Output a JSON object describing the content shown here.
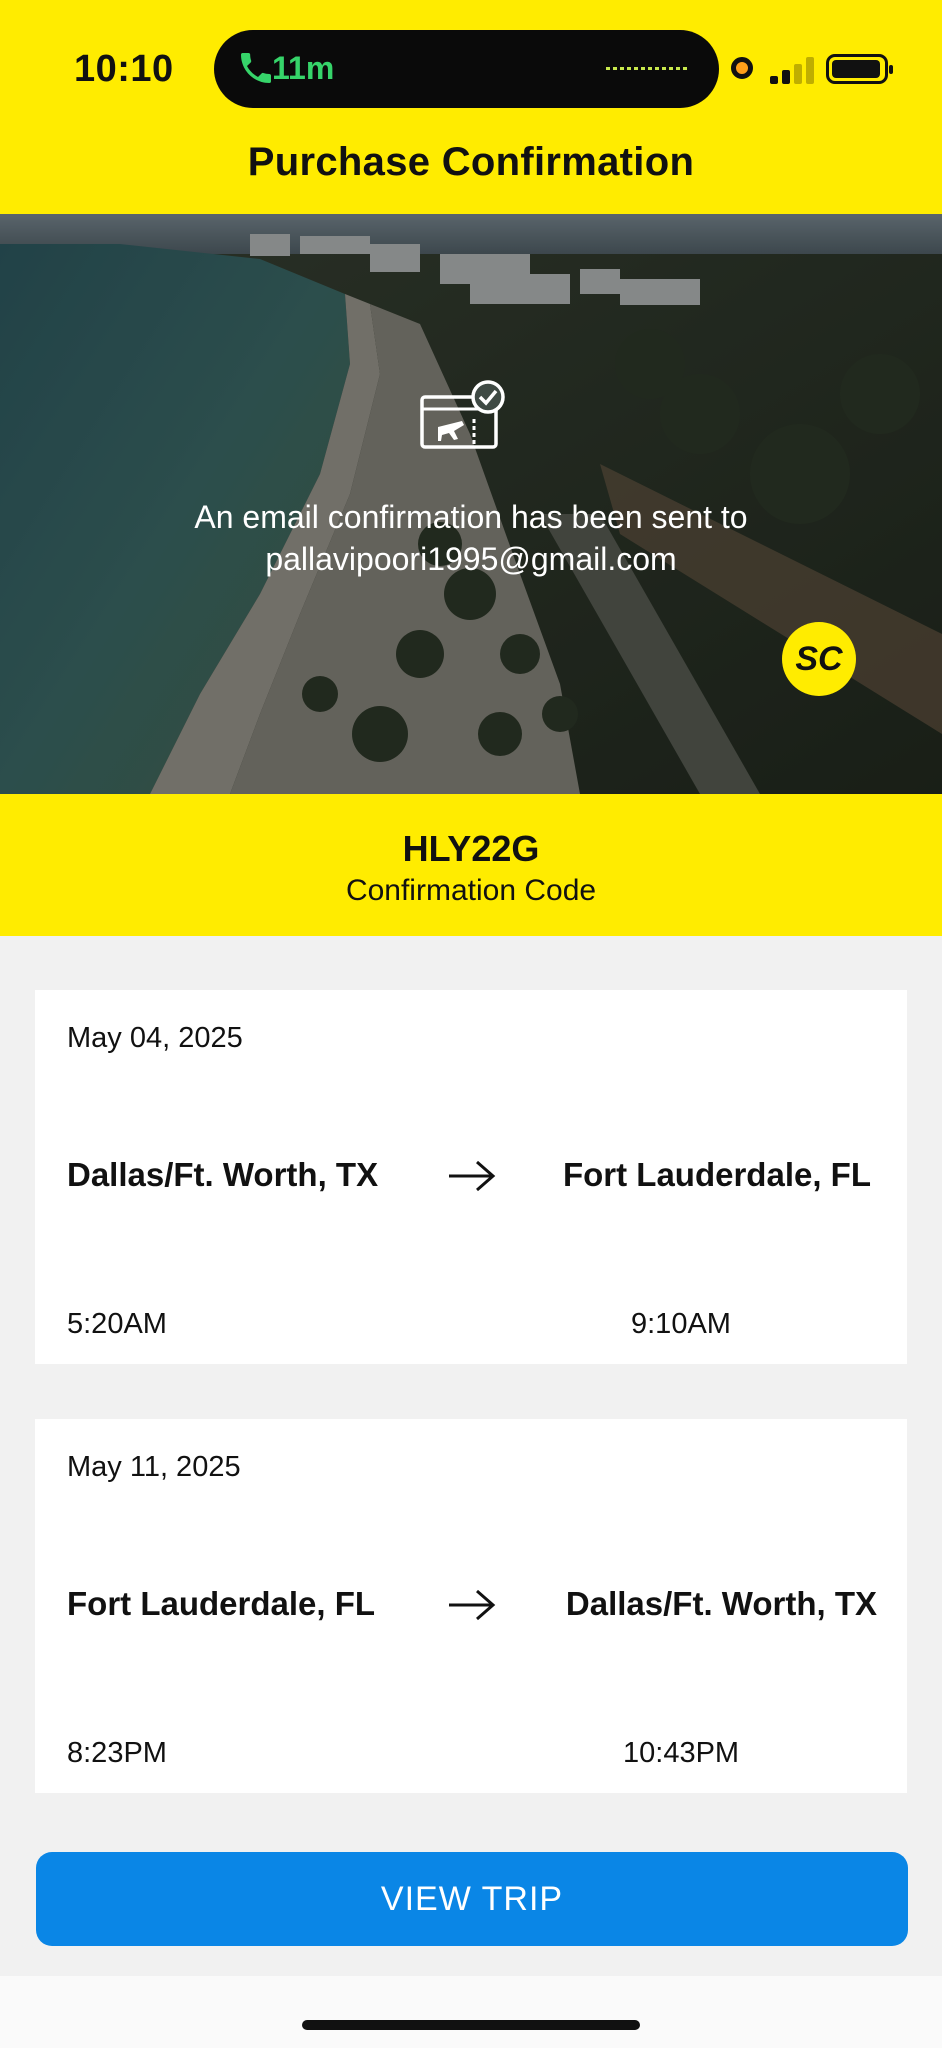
{
  "status_bar": {
    "time": "10:10",
    "call_duration": "11m"
  },
  "header": {
    "title": "Purchase Confirmation"
  },
  "hero": {
    "message_line1": "An email confirmation has been sent to",
    "email": "pallavipoori1995@gmail.com",
    "logo_text": "SC"
  },
  "confirmation": {
    "code": "HLY22G",
    "label": "Confirmation Code"
  },
  "flights": [
    {
      "date": "May 04, 2025",
      "from": "Dallas/Ft. Worth, TX",
      "to": "Fort Lauderdale, FL",
      "depart_time": "5:20AM",
      "arrive_time": "9:10AM"
    },
    {
      "date": "May 11, 2025",
      "from": "Fort Lauderdale, FL",
      "to": "Dallas/Ft. Worth, TX",
      "depart_time": "8:23PM",
      "arrive_time": "10:43PM"
    }
  ],
  "actions": {
    "view_trip_label": "VIEW TRIP"
  },
  "colors": {
    "brand_yellow": "#ffec00",
    "button_blue": "#0a86e6"
  }
}
